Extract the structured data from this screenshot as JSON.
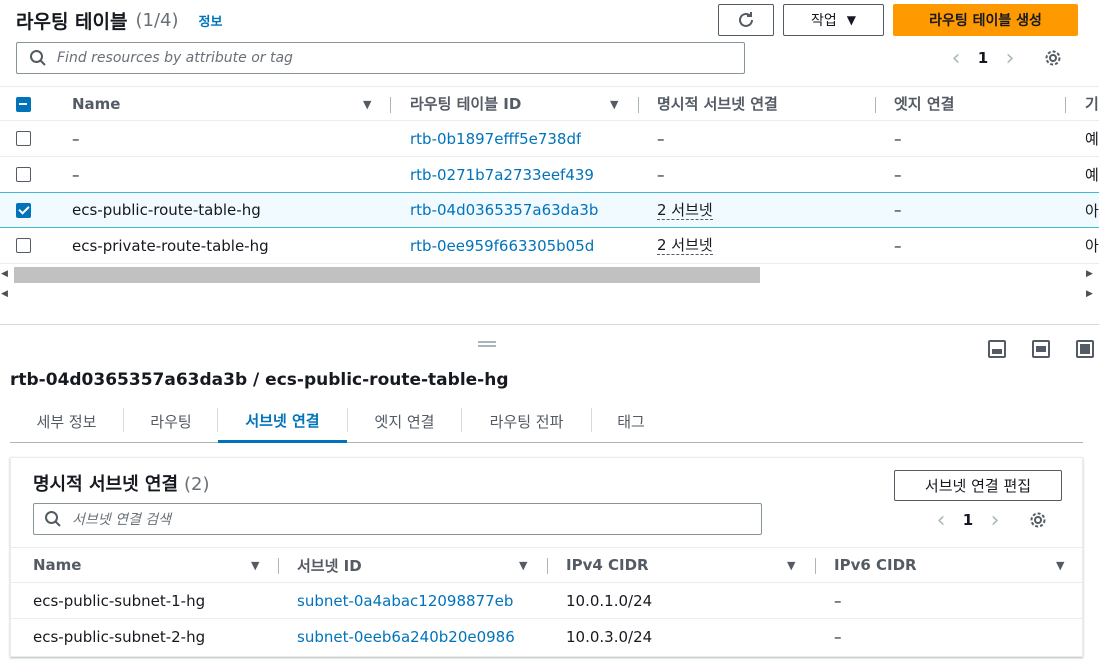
{
  "header": {
    "title": "라우팅 테이블",
    "count": "(1/4)",
    "info_link": "정보",
    "action_label": "작업",
    "create_label": "라우팅 테이블 생성",
    "search_placeholder": "Find resources by attribute or tag",
    "page": "1"
  },
  "table": {
    "columns": [
      "Name",
      "라우팅 테이블 ID",
      "명시적 서브넷 연결",
      "엣지 연결",
      "기"
    ],
    "rows": [
      {
        "name": "–",
        "id": "rtb-0b1897efff5e738df",
        "explicit": "–",
        "edge": "–",
        "extra": "예",
        "selected": false
      },
      {
        "name": "–",
        "id": "rtb-0271b7a2733eef439",
        "explicit": "–",
        "edge": "–",
        "extra": "예",
        "selected": false
      },
      {
        "name": "ecs-public-route-table-hg",
        "id": "rtb-04d0365357a63da3b",
        "explicit": "2 서브넷",
        "edge": "–",
        "extra": "아",
        "selected": true
      },
      {
        "name": "ecs-private-route-table-hg",
        "id": "rtb-0ee959f663305b05d",
        "explicit": "2 서브넷",
        "edge": "–",
        "extra": "아",
        "selected": false
      }
    ]
  },
  "detail": {
    "title": "rtb-04d0365357a63da3b / ecs-public-route-table-hg",
    "tabs": [
      "세부 정보",
      "라우팅",
      "서브넷 연결",
      "엣지 연결",
      "라우팅 전파",
      "태그"
    ],
    "active_tab": "서브넷 연결"
  },
  "subnet_card": {
    "title": "명시적 서브넷 연결",
    "count": "(2)",
    "edit_label": "서브넷 연결 편집",
    "search_placeholder": "서브넷 연결 검색",
    "page": "1",
    "columns": [
      "Name",
      "서브넷 ID",
      "IPv4 CIDR",
      "IPv6 CIDR"
    ],
    "rows": [
      {
        "name": "ecs-public-subnet-1-hg",
        "subnet_id": "subnet-0a4abac12098877eb",
        "ipv4": "10.0.1.0/24",
        "ipv6": "–"
      },
      {
        "name": "ecs-public-subnet-2-hg",
        "subnet_id": "subnet-0eeb6a240b20e0986",
        "ipv4": "10.0.3.0/24",
        "ipv6": "–"
      }
    ]
  },
  "colors": {
    "primary": "#ff9900",
    "link": "#0073bb",
    "selected_bg": "#f1faff"
  }
}
